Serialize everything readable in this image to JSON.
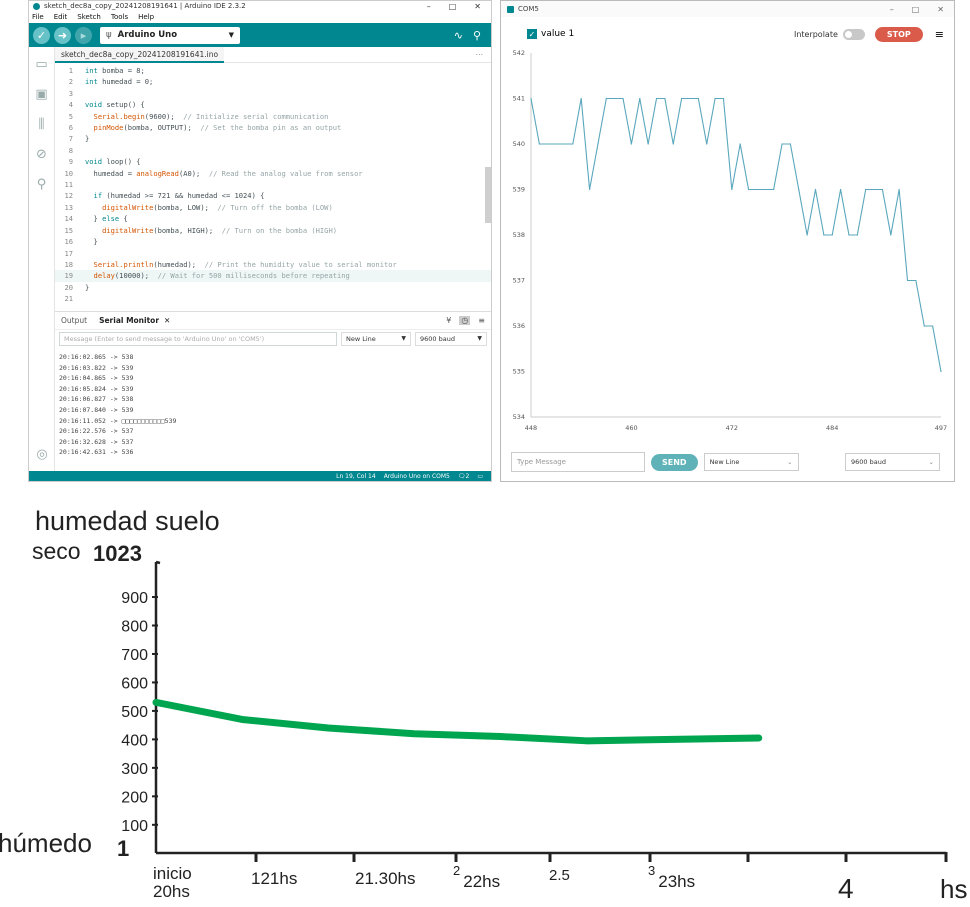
{
  "ide": {
    "title": "sketch_dec8a_copy_20241208191641 | Arduino IDE 2.3.2",
    "menu": [
      "File",
      "Edit",
      "Sketch",
      "Tools",
      "Help"
    ],
    "board": "Arduino Uno",
    "file_tab": "sketch_dec8a_copy_20241208191641.ino",
    "code": [
      {
        "n": "1",
        "t": "int bomba = 8;"
      },
      {
        "n": "2",
        "t": "int humedad = 0;"
      },
      {
        "n": "3",
        "t": ""
      },
      {
        "n": "4",
        "t": "void setup() {"
      },
      {
        "n": "5",
        "t": "  Serial.begin(9600);  // Initialize serial communication"
      },
      {
        "n": "6",
        "t": "  pinMode(bomba, OUTPUT);  // Set the bomba pin as an output"
      },
      {
        "n": "7",
        "t": "}"
      },
      {
        "n": "8",
        "t": ""
      },
      {
        "n": "9",
        "t": "void loop() {"
      },
      {
        "n": "10",
        "t": "  humedad = analogRead(A0);  // Read the analog value from sensor"
      },
      {
        "n": "11",
        "t": ""
      },
      {
        "n": "12",
        "t": "  if (humedad >= 721 && humedad <= 1024) {"
      },
      {
        "n": "13",
        "t": "    digitalWrite(bomba, LOW);  // Turn off the bomba (LOW)"
      },
      {
        "n": "14",
        "t": "  } else {"
      },
      {
        "n": "15",
        "t": "    digitalWrite(bomba, HIGH);  // Turn on the bomba (HIGH)"
      },
      {
        "n": "16",
        "t": "  }"
      },
      {
        "n": "17",
        "t": ""
      },
      {
        "n": "18",
        "t": "  Serial.println(humedad);  // Print the humidity value to serial monitor"
      },
      {
        "n": "19",
        "t": "  delay(10000);  // Wait for 500 milliseconds before repeating"
      },
      {
        "n": "20",
        "t": "}"
      },
      {
        "n": "21",
        "t": ""
      }
    ],
    "tabs": {
      "output": "Output",
      "serial": "Serial Monitor"
    },
    "message_placeholder": "Message (Enter to send message to 'Arduino Uno' on 'COM5')",
    "line_ending": "New Line",
    "baud": "9600 baud",
    "serial_lines": [
      "20:16:02.865 -> 538",
      "20:16:03.822 -> 539",
      "20:16:04.865 -> 539",
      "20:16:05.824 -> 539",
      "20:16:06.827 -> 538",
      "20:16:07.840 -> 539",
      "20:16:11.052 -> □□□□□□□□□□□539",
      "20:16:22.576 -> 537",
      "20:16:32.628 -> 537",
      "20:16:42.631 -> 536"
    ],
    "status": {
      "pos": "Ln 19, Col 14",
      "board": "Arduino Uno on COM5",
      "notif": "2"
    }
  },
  "plotter": {
    "title": "COM5",
    "series_label": "value 1",
    "interpolate": "Interpolate",
    "stop": "STOP",
    "send_placeholder": "Type Message",
    "send": "SEND",
    "line_ending": "New Line",
    "baud": "9600 baud",
    "color": "#5aa7bd",
    "chart_data": {
      "type": "line",
      "ylim": [
        534,
        542
      ],
      "yticks": [
        534,
        535,
        536,
        537,
        538,
        539,
        540,
        541,
        542
      ],
      "xlim": [
        448,
        497
      ],
      "xticks": [
        448,
        460,
        472,
        484,
        497
      ],
      "x": [
        448,
        449,
        450,
        451,
        452,
        453,
        454,
        455,
        456,
        457,
        458,
        459,
        460,
        461,
        462,
        463,
        464,
        465,
        466,
        467,
        468,
        469,
        470,
        471,
        472,
        473,
        474,
        475,
        476,
        477,
        478,
        479,
        480,
        481,
        482,
        483,
        484,
        485,
        486,
        487,
        488,
        489,
        490,
        491,
        492,
        493,
        494,
        495,
        496,
        497
      ],
      "values": [
        541,
        540,
        540,
        540,
        540,
        540,
        541,
        539,
        540,
        541,
        541,
        541,
        540,
        541,
        540,
        541,
        541,
        540,
        541,
        541,
        541,
        540,
        541,
        541,
        539,
        540,
        539,
        539,
        539,
        539,
        540,
        540,
        539,
        538,
        539,
        538,
        538,
        539,
        538,
        538,
        539,
        539,
        539,
        538,
        539,
        537,
        537,
        536,
        536,
        535
      ]
    }
  },
  "sketch": {
    "title": "humedad suelo",
    "top_label": "seco",
    "top_value": "1023",
    "bottom_label": "húmedo",
    "bottom_value": "1",
    "color": "#00a64f",
    "chart_data": {
      "type": "line",
      "title": "humedad suelo",
      "ylim": [
        1,
        1023
      ],
      "yticks": [
        "900",
        "800",
        "700",
        "600",
        "500",
        "400",
        "300",
        "200",
        "100"
      ],
      "xtick_labels": [
        "inicio 20hs",
        "121hs",
        "21.30hs",
        "2 22hs",
        "2.5",
        "3 23hs",
        "",
        "4",
        "hs"
      ],
      "x": [
        0,
        1,
        2,
        3,
        4,
        5,
        6,
        7
      ],
      "values": [
        530,
        470,
        440,
        420,
        410,
        395,
        400,
        405
      ]
    }
  }
}
